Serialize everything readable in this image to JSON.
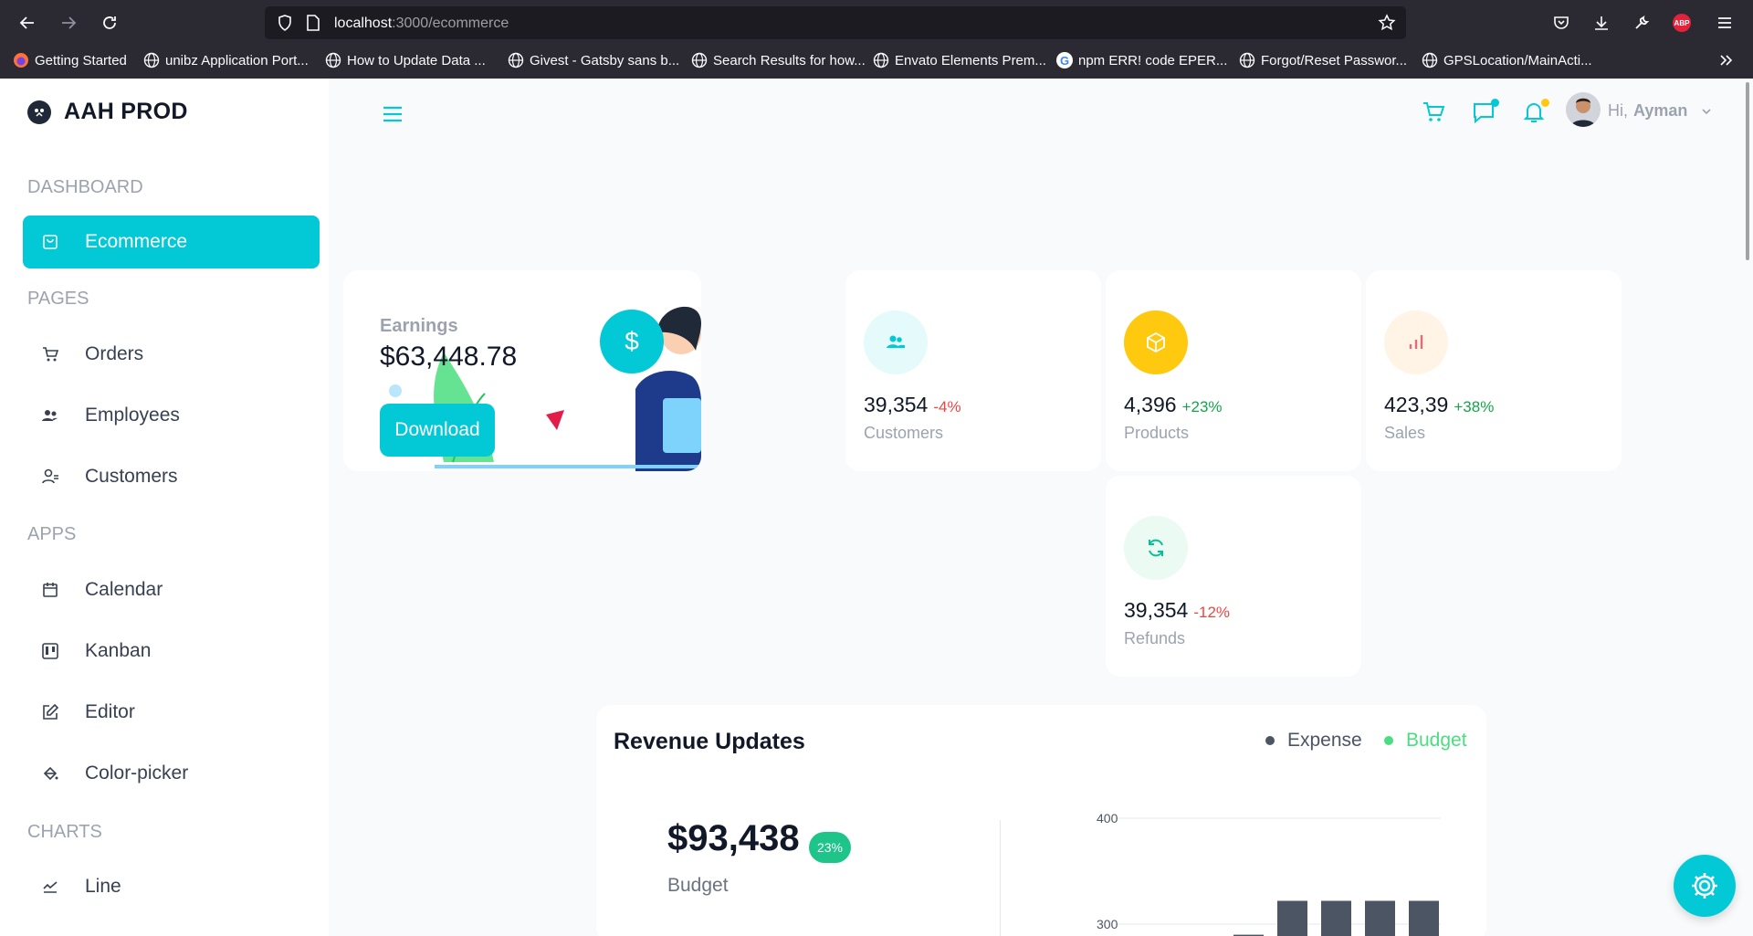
{
  "browser": {
    "url_host": "localhost",
    "url_path": ":3000/ecommerce",
    "bookmarks": [
      {
        "label": "Getting Started",
        "icon": "firefox-icon"
      },
      {
        "label": "unibz Application Port...",
        "icon": "globe-icon"
      },
      {
        "label": "How to Update Data ...",
        "icon": "globe-icon"
      },
      {
        "label": "Givest - Gatsby sans b...",
        "icon": "globe-icon"
      },
      {
        "label": "Search Results for how...",
        "icon": "globe-icon"
      },
      {
        "label": "Envato Elements Prem...",
        "icon": "globe-icon"
      },
      {
        "label": "npm ERR! code EPER...",
        "icon": "google-icon"
      },
      {
        "label": "Forgot/Reset Passwor...",
        "icon": "globe-icon"
      },
      {
        "label": "GPSLocation/MainActi...",
        "icon": "globe-icon"
      }
    ],
    "abp_label": "ABP",
    "google_letter": "G"
  },
  "sidebar": {
    "brand": "AAH PROD",
    "sections": [
      {
        "title": "DASHBOARD",
        "items": [
          {
            "label": "Ecommerce",
            "icon": "shopping-bag-icon",
            "active": true
          }
        ]
      },
      {
        "title": "PAGES",
        "items": [
          {
            "label": "Orders",
            "icon": "cart-icon"
          },
          {
            "label": "Employees",
            "icon": "people-icon"
          },
          {
            "label": "Customers",
            "icon": "user-icon"
          }
        ]
      },
      {
        "title": "APPS",
        "items": [
          {
            "label": "Calendar",
            "icon": "calendar-icon"
          },
          {
            "label": "Kanban",
            "icon": "kanban-icon"
          },
          {
            "label": "Editor",
            "icon": "edit-icon"
          },
          {
            "label": "Color-picker",
            "icon": "paint-bucket-icon"
          }
        ]
      },
      {
        "title": "CHARTS",
        "items": [
          {
            "label": "Line",
            "icon": "line-chart-icon"
          }
        ]
      }
    ]
  },
  "navbar": {
    "greeting": "Hi,",
    "user_name": "Ayman",
    "message_dot_color": "#03c9d7",
    "notification_dot_color": "#fec90f"
  },
  "earnings": {
    "label": "Earnings",
    "value": "$63,448.78",
    "button": "Download",
    "badge": "$"
  },
  "stats": [
    {
      "value": "39,354",
      "pct": "-4%",
      "label": "Customers",
      "icon": "customers-icon",
      "icon_color": "#03c9d7",
      "icon_bg": "#e5fafb",
      "pct_color": "#ef4444"
    },
    {
      "value": "4,396",
      "pct": "+23%",
      "label": "Products",
      "icon": "box-icon",
      "icon_color": "#ffffff",
      "icon_bg": "#fec90f",
      "pct_color": "#16a34a"
    },
    {
      "value": "423,39",
      "pct": "+38%",
      "label": "Sales",
      "icon": "bar-chart-icon",
      "icon_color": "#e46a76",
      "icon_bg": "#fff4e5",
      "pct_color": "#16a34a"
    },
    {
      "value": "39,354",
      "pct": "-12%",
      "label": "Refunds",
      "icon": "refresh-icon",
      "icon_color": "#00c292",
      "icon_bg": "#ebfaf2",
      "pct_color": "#ef4444"
    }
  ],
  "revenue": {
    "title": "Revenue Updates",
    "legend_expense": "Expense",
    "legend_budget": "Budget",
    "expense_color": "#4b5563",
    "budget_color": "#4ade80",
    "budget_value": "$93,438",
    "budget_pct": "23%",
    "budget_label": "Budget",
    "y_ticks": [
      "400",
      "300"
    ],
    "bar_values": [
      290,
      322,
      322,
      322,
      322
    ]
  },
  "colors": {
    "accent": "#03c9d7"
  }
}
